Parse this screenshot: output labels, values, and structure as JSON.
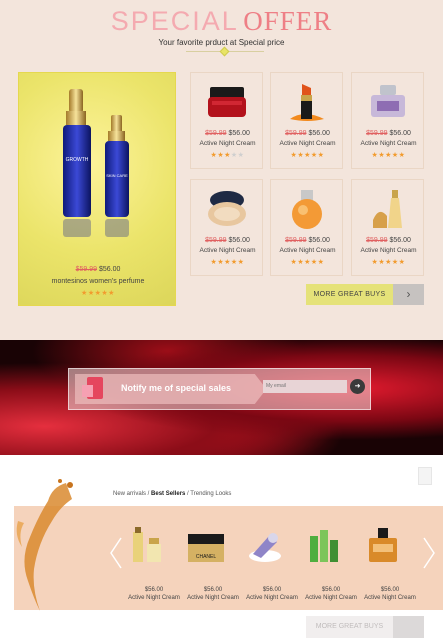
{
  "header": {
    "title_part1": "SPECIAL",
    "title_part2": "OFFER",
    "subtitle": "Your favorite prduct at Special price"
  },
  "featured": {
    "old_price": "$59.99",
    "new_price": "$56.00",
    "name": "montesinos women's perfume",
    "rating_stars": "★★★★★",
    "bottle_label": "GROWTH"
  },
  "products": [
    {
      "old_price": "$59.99",
      "new_price": "$56.00",
      "name": "Active Night Cream",
      "stars": "★★★",
      "stars_off": "★★",
      "icon": "cream-jar-icon"
    },
    {
      "old_price": "$59.99",
      "new_price": "$56.00",
      "name": "Active Night Cream",
      "stars": "★★★★★",
      "stars_off": "",
      "icon": "lipstick-icon"
    },
    {
      "old_price": "$59.99",
      "new_price": "$56.00",
      "name": "Active Night Cream",
      "stars": "★★★★★",
      "stars_off": "",
      "icon": "perfume-bottle-icon"
    },
    {
      "old_price": "$59.99",
      "new_price": "$56.00",
      "name": "Active Night Cream",
      "stars": "★★★★★",
      "stars_off": "",
      "icon": "compact-powder-icon"
    },
    {
      "old_price": "$59.99",
      "new_price": "$56.00",
      "name": "Active Night Cream",
      "stars": "★★★★★",
      "stars_off": "",
      "icon": "perfume-round-icon"
    },
    {
      "old_price": "$59.99",
      "new_price": "$56.00",
      "name": "Active Night Cream",
      "stars": "★★★★★",
      "stars_off": "",
      "icon": "perfume-gold-icon"
    }
  ],
  "more_button": {
    "label": "MORE GREAT BUYS",
    "arrow": "›"
  },
  "newsletter": {
    "label": "Notify me of special sales",
    "email_placeholder": "My email",
    "send_glyph": "➜"
  },
  "tabs": {
    "new_arrivals": "New arrivals",
    "sep1": " / ",
    "best_sellers": "Best Sellers",
    "sep2": " / ",
    "trending": "Trending Looks"
  },
  "carousel": [
    {
      "price": "$56.00",
      "name": "Active Night Cream",
      "icon": "skincare-set-icon"
    },
    {
      "price": "$56.00",
      "name": "Active Night Cream",
      "icon": "chanel-jar-icon",
      "brand": "CHANEL"
    },
    {
      "price": "$56.00",
      "name": "Active Night Cream",
      "icon": "cream-tube-icon"
    },
    {
      "price": "$56.00",
      "name": "Active Night Cream",
      "icon": "green-bottles-icon"
    },
    {
      "price": "$56.00",
      "name": "Active Night Cream",
      "icon": "perfume-amber-icon"
    }
  ],
  "colors": {
    "accent_pink": "#ee7f86",
    "yellow_button": "#e5e279",
    "band_peach": "#f5d3bc",
    "star": "#f29b2e",
    "old_price_red": "#e06060"
  }
}
